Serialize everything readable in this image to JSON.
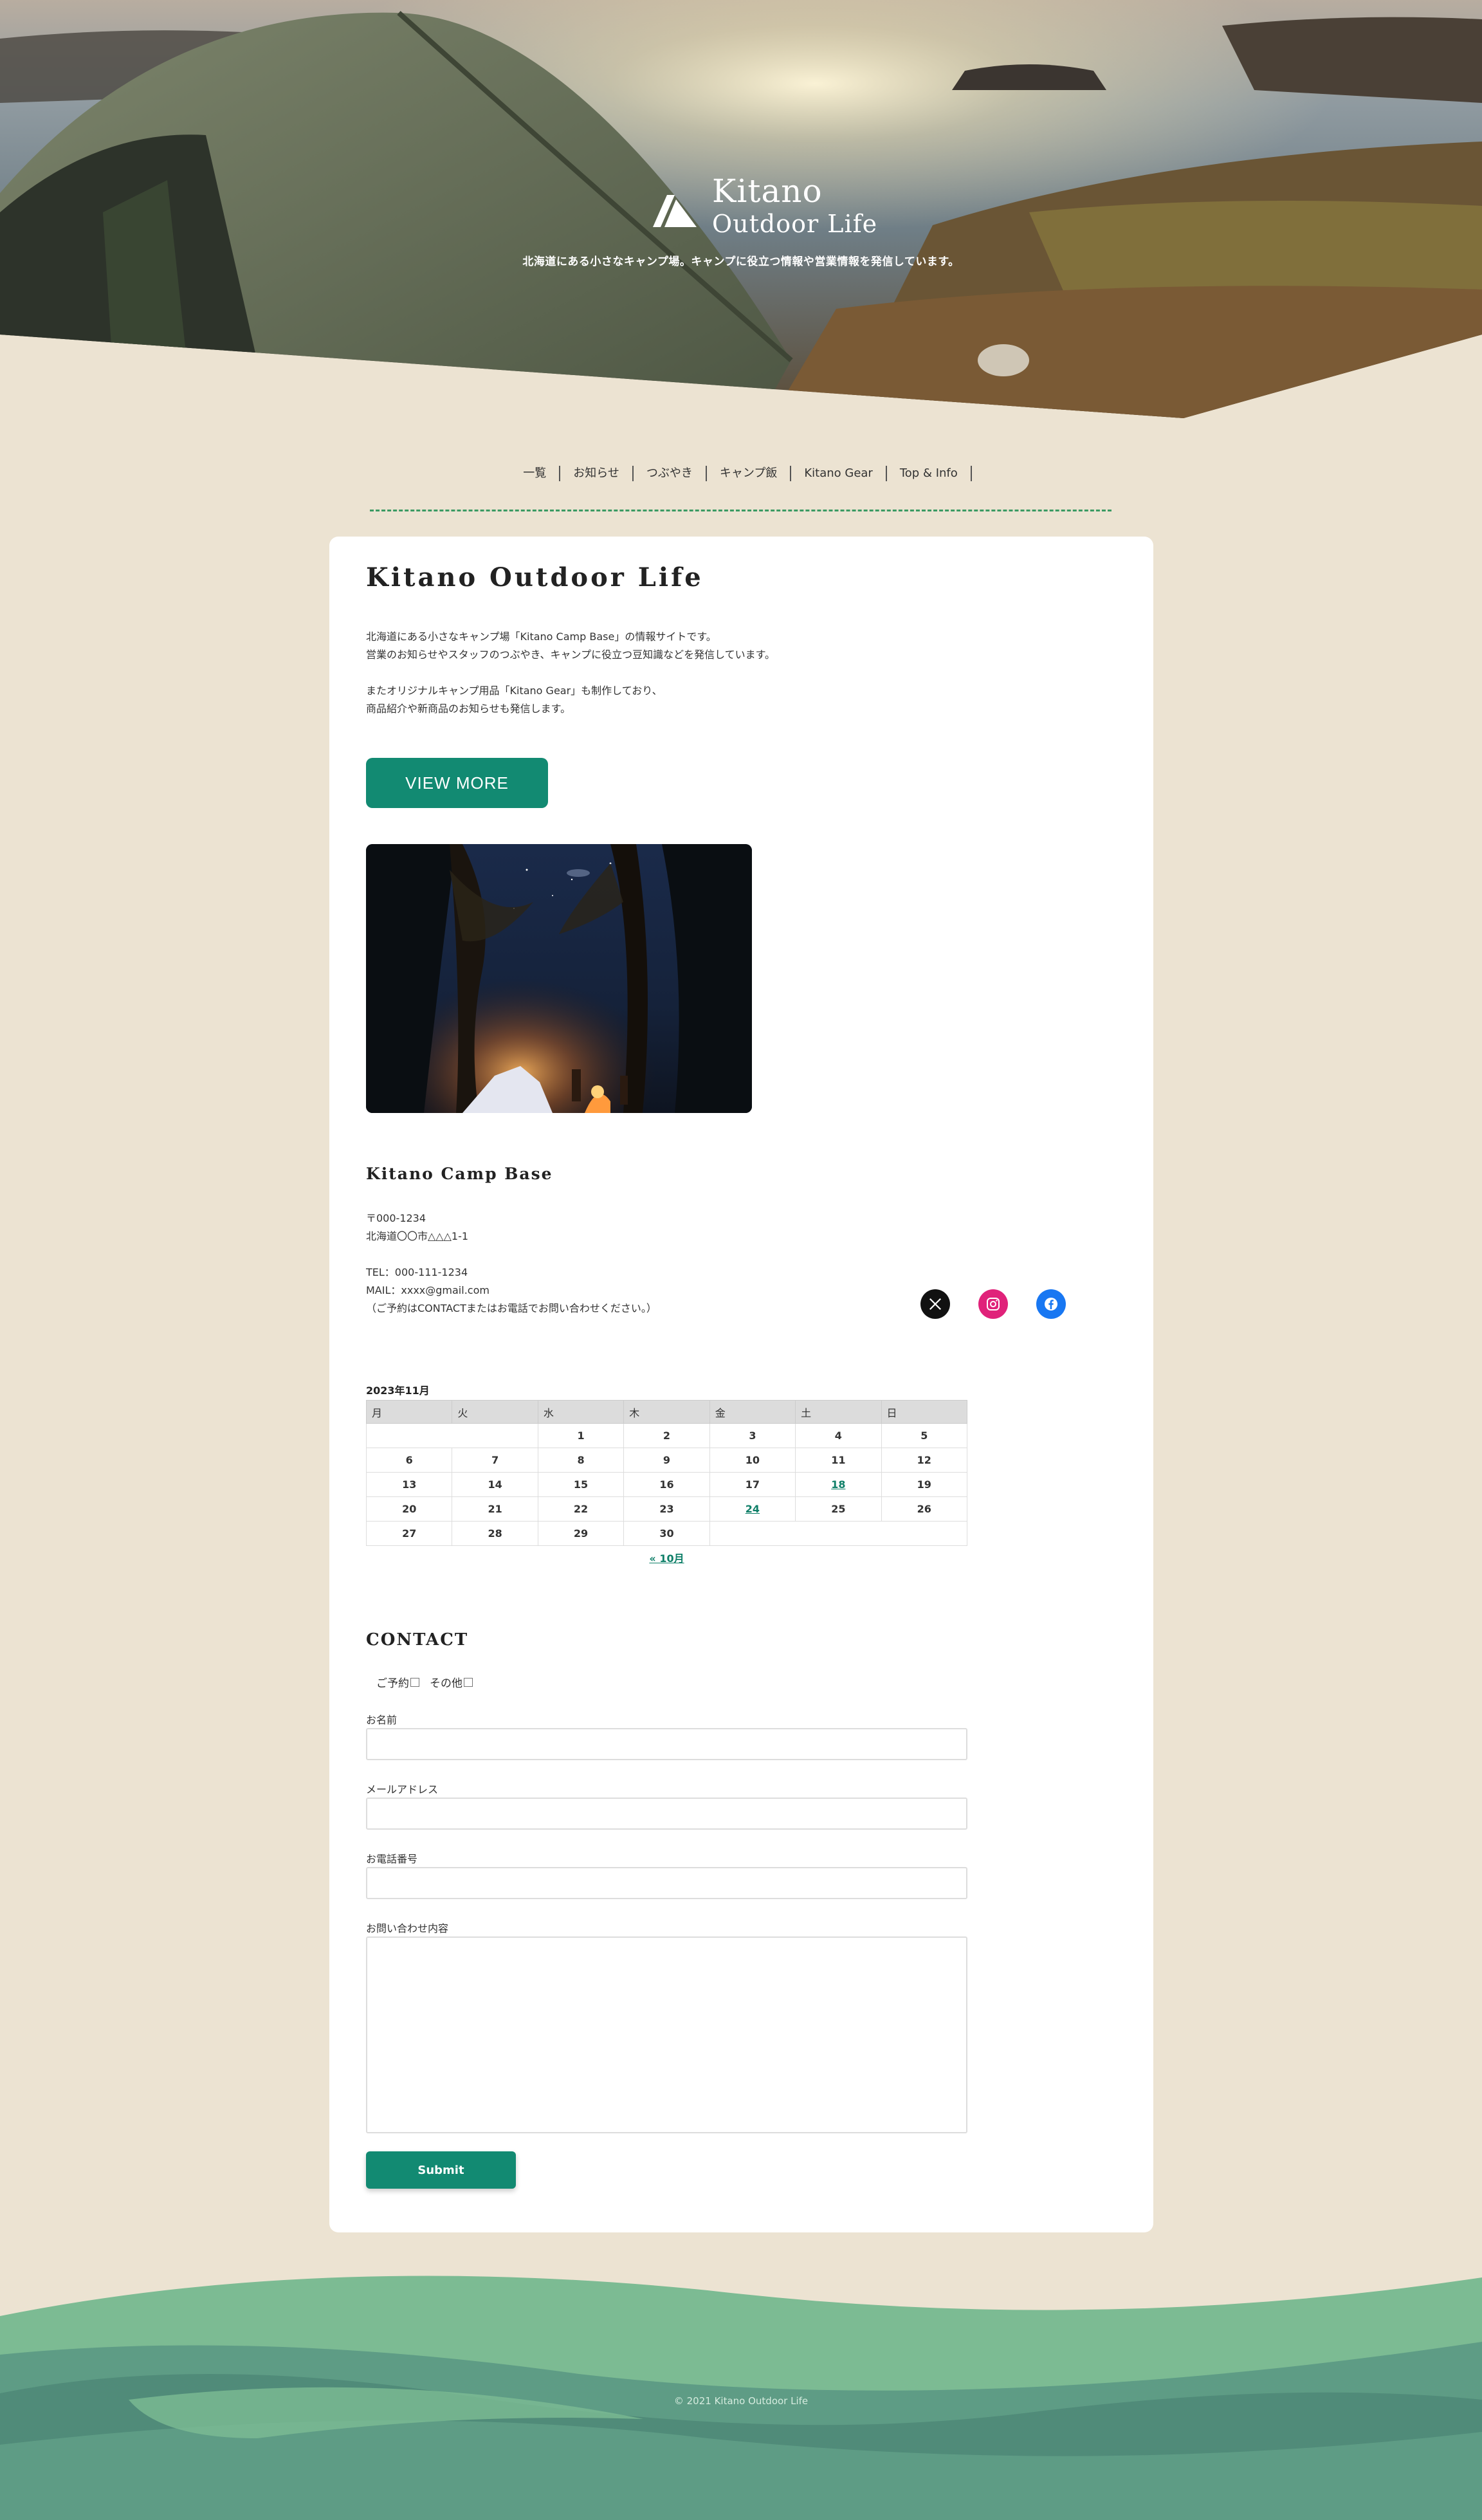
{
  "hero": {
    "brand_line1": "Kitano",
    "brand_line2": "Outdoor Life",
    "tagline": "北海道にある小さなキャンプ場。キャンプに役立つ情報や営業情報を発信しています。"
  },
  "nav": {
    "items": [
      "一覧",
      "お知らせ",
      "つぶやき",
      "キャンプ飯",
      "Kitano Gear",
      "Top & Info"
    ]
  },
  "main": {
    "title": "Kitano Outdoor Life",
    "intro": [
      "北海道にある小さなキャンプ場「Kitano Camp Base」の情報サイトです。",
      "営業のお知らせやスタッフのつぶやき、キャンプに役立つ豆知識などを発信しています。",
      "またオリジナルキャンプ用品「Kitano Gear」も制作しており、",
      "商品紹介や新商品のお知らせも発信します。"
    ],
    "view_more": "VIEW MORE"
  },
  "shop": {
    "name": "Kitano Camp Base",
    "postal": "〒000-1234",
    "address": "北海道〇〇市△△△1-1",
    "tel": "TEL：000-111-1234",
    "mail": "MAIL：xxxx@gmail.com",
    "note": "（ご予約はCONTACTまたはお電話でお問い合わせください。）",
    "socials": [
      "x-icon",
      "instagram-icon",
      "facebook-icon"
    ]
  },
  "calendar": {
    "caption": "2023年11月",
    "weekdays": [
      "月",
      "火",
      "水",
      "木",
      "金",
      "土",
      "日"
    ],
    "weeks": [
      [
        "",
        "",
        "1",
        "2",
        "3",
        "4",
        "5"
      ],
      [
        "6",
        "7",
        "8",
        "9",
        "10",
        "11",
        "12"
      ],
      [
        "13",
        "14",
        "15",
        "16",
        "17",
        "18",
        "19"
      ],
      [
        "20",
        "21",
        "22",
        "23",
        "24",
        "25",
        "26"
      ],
      [
        "27",
        "28",
        "29",
        "30",
        "",
        "",
        ""
      ]
    ],
    "linked_days": [
      "18",
      "24"
    ],
    "prev_label": "« 10月"
  },
  "contact": {
    "title": "CONTACT",
    "check_reserve": "ご予約",
    "check_other": "その他",
    "name_label": "お名前",
    "email_label": "メールアドレス",
    "phone_label": "お電話番号",
    "message_label": "お問い合わせ内容",
    "submit": "Submit"
  },
  "footer": {
    "copyright": "© 2021 Kitano Outdoor Life"
  },
  "colors": {
    "accent": "#128a72",
    "background": "#ece3d2",
    "footer_light": "#7cbb93",
    "footer_mid": "#5e9c85"
  }
}
